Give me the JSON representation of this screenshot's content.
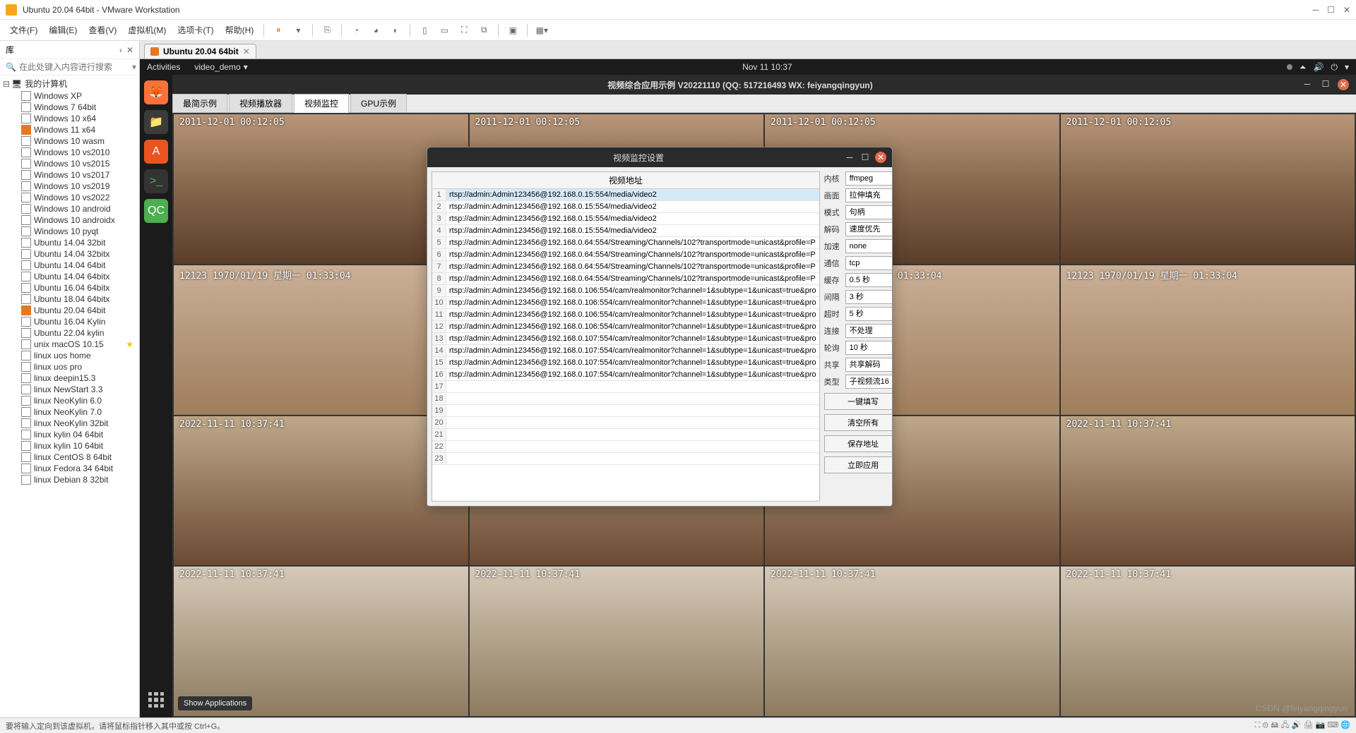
{
  "vmware": {
    "title": "Ubuntu 20.04 64bit - VMware Workstation",
    "menu": {
      "file": "文件(F)",
      "edit": "编辑(E)",
      "view": "查看(V)",
      "vm": "虚拟机(M)",
      "tabs": "选项卡(T)",
      "help": "帮助(H)"
    },
    "library_title": "库",
    "search_placeholder": "在此处键入内容进行搜索",
    "root": "我的计算机",
    "vms": [
      {
        "name": "Windows XP",
        "on": false
      },
      {
        "name": "Windows 7 64bit",
        "on": false
      },
      {
        "name": "Windows 10 x64",
        "on": false
      },
      {
        "name": "Windows 11 x64",
        "on": true
      },
      {
        "name": "Windows 10 wasm",
        "on": false
      },
      {
        "name": "Windows 10 vs2010",
        "on": false
      },
      {
        "name": "Windows 10 vs2015",
        "on": false
      },
      {
        "name": "Windows 10 vs2017",
        "on": false
      },
      {
        "name": "Windows 10 vs2019",
        "on": false
      },
      {
        "name": "Windows 10 vs2022",
        "on": false
      },
      {
        "name": "Windows 10 android",
        "on": false
      },
      {
        "name": "Windows 10 androidx",
        "on": false
      },
      {
        "name": "Windows 10 pyqt",
        "on": false
      },
      {
        "name": "Ubuntu 14.04 32bit",
        "on": false
      },
      {
        "name": "Ubuntu 14.04 32bitx",
        "on": false
      },
      {
        "name": "Ubuntu 14.04 64bit",
        "on": false
      },
      {
        "name": "Ubuntu 14.04 64bitx",
        "on": false
      },
      {
        "name": "Ubuntu 16.04 64bitx",
        "on": false
      },
      {
        "name": "Ubuntu 18.04 64bitx",
        "on": false
      },
      {
        "name": "Ubuntu 20.04 64bit",
        "on": true,
        "selected": false
      },
      {
        "name": "Ubuntu 16.04 Kylin",
        "on": false
      },
      {
        "name": "Ubuntu 22.04 kylin",
        "on": false
      },
      {
        "name": "unix macOS 10.15",
        "on": false,
        "star": true
      },
      {
        "name": "linux uos home",
        "on": false
      },
      {
        "name": "linux uos pro",
        "on": false
      },
      {
        "name": "linux deepin15.3",
        "on": false
      },
      {
        "name": "linux NewStart 3.3",
        "on": false
      },
      {
        "name": "linux NeoKylin 6.0",
        "on": false
      },
      {
        "name": "linux NeoKylin 7.0",
        "on": false
      },
      {
        "name": "linux NeoKylin 32bit",
        "on": false
      },
      {
        "name": "linux kylin 04 64bit",
        "on": false
      },
      {
        "name": "linux kylin 10 64bit",
        "on": false
      },
      {
        "name": "linux CentOS 8 64bit",
        "on": false
      },
      {
        "name": "linux Fedora 34 64bit",
        "on": false
      },
      {
        "name": "linux Debian 8 32bit",
        "on": false
      }
    ],
    "tab_name": "Ubuntu 20.04 64bit",
    "status": "要将输入定向到该虚拟机，请将鼠标指针移入其中或按 Ctrl+G。",
    "status_right": "CSDN @feiyangqingyun"
  },
  "ubuntu": {
    "activities": "Activities",
    "app_name": "video_demo",
    "clock": "Nov 11  10:37",
    "tooltip": "Show Applications"
  },
  "app": {
    "title": "视频综合应用示例 V20221110 (QQ: 517216493 WX: feiyangqingyun)",
    "tabs": {
      "t1": "最简示例",
      "t2": "视频播放器",
      "t3": "视频监控",
      "t4": "GPU示例"
    },
    "timestamps": {
      "a": "2011-12-01 00:12:05",
      "b": "12123   1970/01/19 星期一 01:33:04",
      "c": "2022-11-11 10:37:41",
      "d": "2022-11-11 10:37:41"
    }
  },
  "dialog": {
    "title": "视频监控设置",
    "addr_header": "视频地址",
    "urls": [
      "rtsp://admin:Admin123456@192.168.0.15:554/media/video2",
      "rtsp://admin:Admin123456@192.168.0.15:554/media/video2",
      "rtsp://admin:Admin123456@192.168.0.15:554/media/video2",
      "rtsp://admin:Admin123456@192.168.0.15:554/media/video2",
      "rtsp://admin:Admin123456@192.168.0.64:554/Streaming/Channels/102?transportmode=unicast&profile=P",
      "rtsp://admin:Admin123456@192.168.0.64:554/Streaming/Channels/102?transportmode=unicast&profile=P",
      "rtsp://admin:Admin123456@192.168.0.64:554/Streaming/Channels/102?transportmode=unicast&profile=P",
      "rtsp://admin:Admin123456@192.168.0.64:554/Streaming/Channels/102?transportmode=unicast&profile=P",
      "rtsp://admin:Admin123456@192.168.0.106:554/cam/realmonitor?channel=1&subtype=1&unicast=true&pro",
      "rtsp://admin:Admin123456@192.168.0.106:554/cam/realmonitor?channel=1&subtype=1&unicast=true&pro",
      "rtsp://admin:Admin123456@192.168.0.106:554/cam/realmonitor?channel=1&subtype=1&unicast=true&pro",
      "rtsp://admin:Admin123456@192.168.0.106:554/cam/realmonitor?channel=1&subtype=1&unicast=true&pro",
      "rtsp://admin:Admin123456@192.168.0.107:554/cam/realmonitor?channel=1&subtype=1&unicast=true&pro",
      "rtsp://admin:Admin123456@192.168.0.107:554/cam/realmonitor?channel=1&subtype=1&unicast=true&pro",
      "rtsp://admin:Admin123456@192.168.0.107:554/cam/realmonitor?channel=1&subtype=1&unicast=true&pro",
      "rtsp://admin:Admin123456@192.168.0.107:554/cam/realmonitor?channel=1&subtype=1&unicast=true&pro",
      "",
      "",
      "",
      "",
      "",
      "",
      ""
    ],
    "settings": [
      {
        "label": "内核",
        "value": "ffmpeg"
      },
      {
        "label": "画面",
        "value": "拉伸填充"
      },
      {
        "label": "模式",
        "value": "句柄"
      },
      {
        "label": "解码",
        "value": "速度优先"
      },
      {
        "label": "加速",
        "value": "none"
      },
      {
        "label": "通信",
        "value": "tcp"
      },
      {
        "label": "缓存",
        "value": "0.5 秒"
      },
      {
        "label": "间隔",
        "value": "3 秒"
      },
      {
        "label": "超时",
        "value": "5 秒"
      },
      {
        "label": "连接",
        "value": "不处理"
      },
      {
        "label": "轮询",
        "value": "10 秒"
      },
      {
        "label": "共享",
        "value": "共享解码"
      },
      {
        "label": "类型",
        "value": "子视频流16"
      }
    ],
    "buttons": {
      "fill": "一键填写",
      "clear": "清空所有",
      "save": "保存地址",
      "apply": "立即应用"
    }
  }
}
